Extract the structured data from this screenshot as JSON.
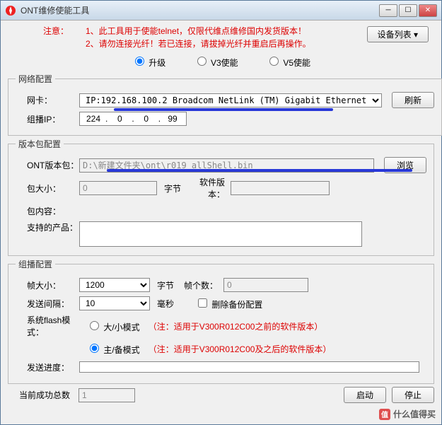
{
  "window": {
    "title": "ONT维修使能工具"
  },
  "notice": {
    "label": "注意：",
    "line1": "1、此工具用于使能telnet，仅限代维点维修国内发货版本！",
    "line2": "2、请勿连接光纤！若已连接，请拔掉光纤并重启后再操作。"
  },
  "device_list_btn": "设备列表 ▾",
  "mode": {
    "upgrade": "升级",
    "v3": "V3使能",
    "v5": "V5使能"
  },
  "net": {
    "legend": "网络配置",
    "nic_label": "网卡：",
    "nic_value": "IP:192.168.100.2 Broadcom NetLink (TM) Gigabit Ethernet",
    "refresh": "刷新",
    "mip_label": "组播IP：",
    "mip": [
      "224",
      "0",
      "0",
      "99"
    ]
  },
  "pkg": {
    "legend": "版本包配置",
    "path_label": "ONT版本包：",
    "path_value": "D:\\新建文件夹\\ont\\r019_allShell.bin",
    "browse": "浏览",
    "size_label": "包大小：",
    "size_value": "0",
    "size_unit": "字节",
    "ver_label": "软件版本：",
    "ver_value": "",
    "content_label": "包内容：",
    "support_label": "支持的产品："
  },
  "mc": {
    "legend": "组播配置",
    "fsize_label": "帧大小：",
    "fsize_value": "1200",
    "fsize_unit": "字节",
    "fcount_label": "帧个数：",
    "fcount_value": "0",
    "interval_label": "发送间隔：",
    "interval_value": "10",
    "interval_unit": "毫秒",
    "delbak": "删除备份配置",
    "flash_label": "系统flash模式：",
    "flash_small": "大/小模式",
    "flash_small_note": "（注：适用于V300R012C00之前的软件版本）",
    "flash_main": "主/备模式",
    "flash_main_note": "（注：适用于V300R012C00及之后的软件版本）",
    "progress_label": "发送进度："
  },
  "footer": {
    "success_label": "当前成功总数",
    "success_value": "1",
    "start": "启动",
    "stop": "停止"
  },
  "watermark": "什么值得买"
}
